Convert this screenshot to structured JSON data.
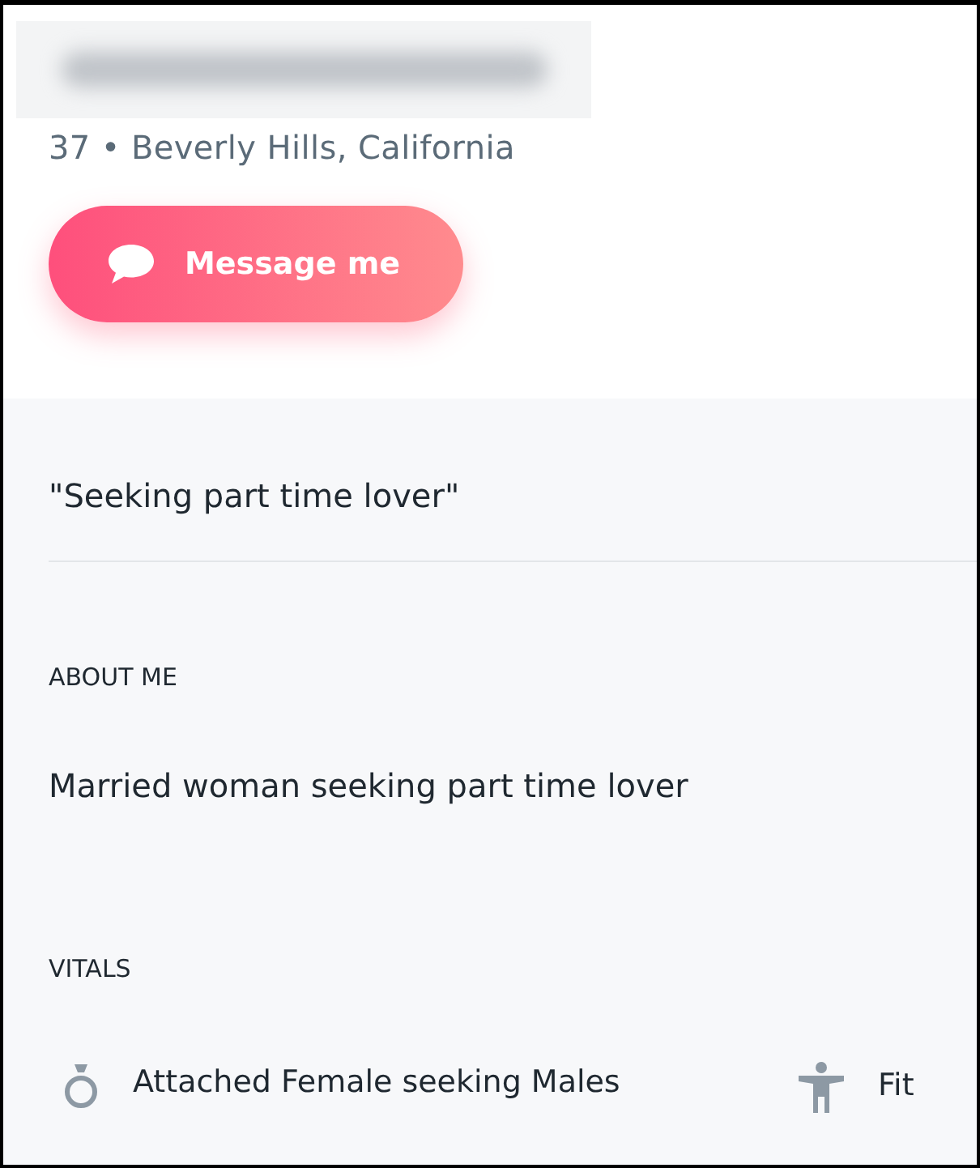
{
  "profile": {
    "subtitle": "37 • Beverly Hills, California",
    "message_button": "Message me"
  },
  "headline": "\"Seeking part time lover\"",
  "about": {
    "heading": "ABOUT ME",
    "text": "Married woman seeking part time lover"
  },
  "vitals": {
    "heading": "VITALS",
    "items": [
      {
        "kind": "relationship",
        "text": "Attached Female seeking Males"
      },
      {
        "kind": "body",
        "text": "Fit"
      }
    ]
  }
}
